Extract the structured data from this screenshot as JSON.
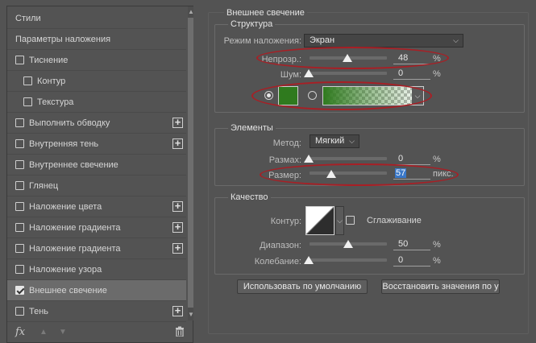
{
  "styles_panel": {
    "items": [
      {
        "label": "Стили",
        "type": "header"
      },
      {
        "label": "Параметры наложения",
        "type": "header"
      },
      {
        "label": "Тиснение",
        "type": "check",
        "checked": false
      },
      {
        "label": "Контур",
        "type": "sub",
        "checked": false
      },
      {
        "label": "Текстура",
        "type": "sub",
        "checked": false
      },
      {
        "label": "Выполнить обводку",
        "type": "check",
        "checked": false,
        "plus": true
      },
      {
        "label": "Внутренняя тень",
        "type": "check",
        "checked": false,
        "plus": true
      },
      {
        "label": "Внутреннее свечение",
        "type": "check",
        "checked": false
      },
      {
        "label": "Глянец",
        "type": "check",
        "checked": false
      },
      {
        "label": "Наложение цвета",
        "type": "check",
        "checked": false,
        "plus": true
      },
      {
        "label": "Наложение градиента",
        "type": "check",
        "checked": false,
        "plus": true
      },
      {
        "label": "Наложение градиента",
        "type": "check",
        "checked": false,
        "plus": true
      },
      {
        "label": "Наложение узора",
        "type": "check",
        "checked": false
      },
      {
        "label": "Внешнее свечение",
        "type": "check",
        "checked": true,
        "active": true
      },
      {
        "label": "Тень",
        "type": "check",
        "checked": false,
        "plus": true
      }
    ],
    "plus_symbol": "+",
    "fx_label": "fx",
    "up_icon": "▲",
    "down_icon": "▼",
    "trash_icon": "🗑"
  },
  "outer_glow": {
    "title": "Внешнее свечение",
    "structure": {
      "title": "Структура",
      "blend_mode_label": "Режим наложения:",
      "blend_mode_value": "Экран",
      "opacity_label": "Непрозр.:",
      "opacity_value": "48",
      "noise_label": "Шум:",
      "noise_value": "0",
      "percent": "%",
      "color_hex": "#2f7a1e"
    },
    "elements": {
      "title": "Элементы",
      "method_label": "Метод:",
      "method_value": "Мягкий",
      "spread_label": "Размах:",
      "spread_value": "0",
      "size_label": "Размер:",
      "size_value": "57",
      "size_unit": "пикс.",
      "percent": "%"
    },
    "quality": {
      "title": "Качество",
      "contour_label": "Контур:",
      "antialias_label": "Сглаживание",
      "range_label": "Диапазон:",
      "range_value": "50",
      "jitter_label": "Колебание:",
      "jitter_value": "0",
      "percent": "%"
    },
    "buttons": {
      "default_label": "Использовать по умолчанию",
      "reset_label": "Восстановить значения по у"
    }
  },
  "colors": {
    "annotation_red": "#a81f25",
    "glow_green": "#2f7a1e"
  }
}
